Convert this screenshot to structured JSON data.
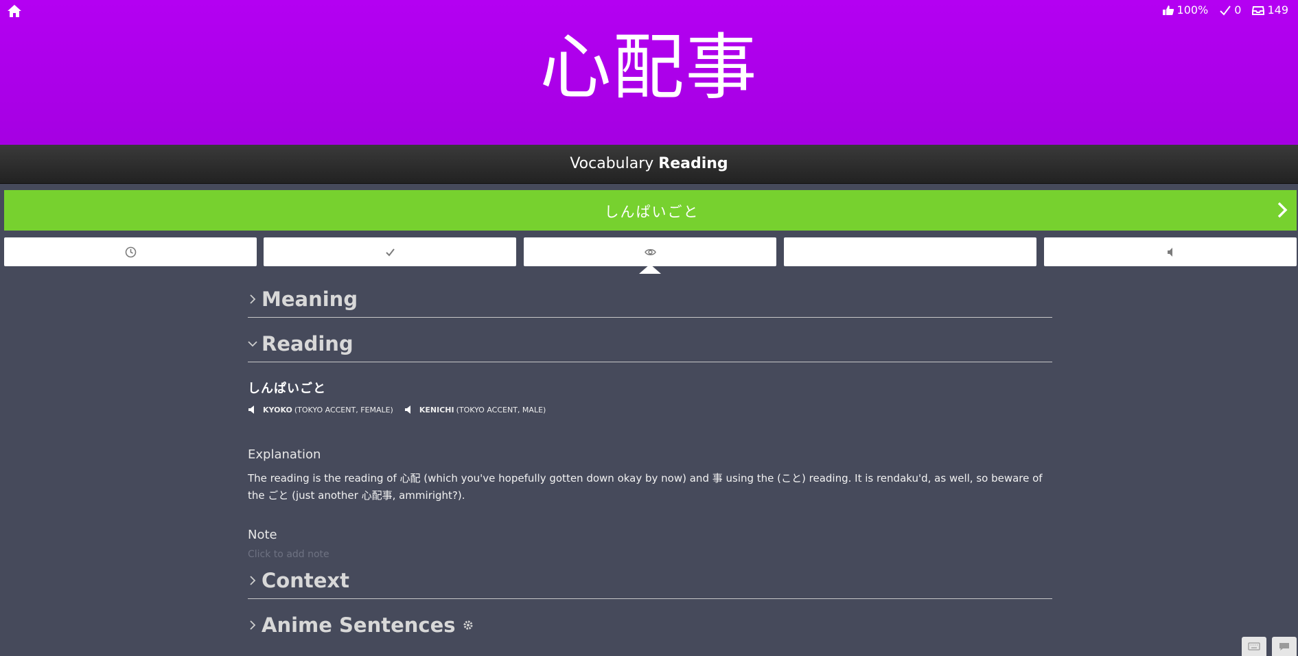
{
  "header": {
    "character": "心配事",
    "stats": {
      "percent": "100%",
      "correct": "0",
      "remaining": "149"
    }
  },
  "type_bar": {
    "category": "Vocabulary",
    "question_type": "Reading"
  },
  "answer": {
    "value": "しんぱいごと"
  },
  "additional_buttons": [
    {
      "icon": "clock-icon"
    },
    {
      "icon": "check-icon"
    },
    {
      "icon": "eye-icon"
    },
    {
      "icon": ""
    },
    {
      "icon": "speaker-icon"
    }
  ],
  "sections": {
    "meaning": "Meaning",
    "reading": "Reading",
    "context": "Context",
    "anime": "Anime Sentences"
  },
  "reading": {
    "text": "しんぱいごと",
    "audio": [
      {
        "name": "KYOKO",
        "detail": "(TOKYO ACCENT, FEMALE)"
      },
      {
        "name": "KENICHI",
        "detail": "(TOKYO ACCENT, MALE)"
      }
    ],
    "explanation_title": "Explanation",
    "explanation": "The reading is the reading of 心配 (which you've hopefully gotten down okay by now) and 事 using the (こと) reading. It is rendaku'd, as well, so beware of the ごと (just another 心配事, ammiright?).",
    "note_title": "Note",
    "note_placeholder": "Click to add note"
  },
  "colors": {
    "header_bg": "#aa00e6",
    "correct_green": "#77d12f",
    "page_bg": "#464a5b"
  }
}
